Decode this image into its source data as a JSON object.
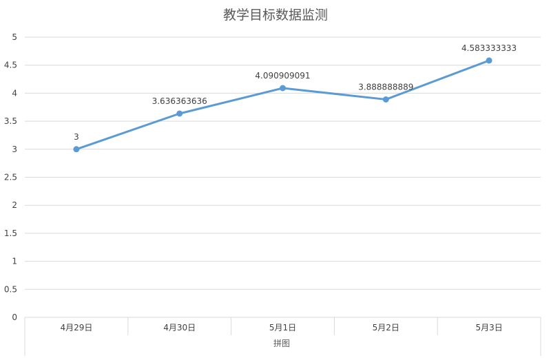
{
  "chart_data": {
    "type": "line",
    "title": "教学目标数据监测",
    "xlabel": "拼图",
    "ylabel": "",
    "categories": [
      "4月29日",
      "4月30日",
      "5月1日",
      "5月2日",
      "5月3日"
    ],
    "series": [
      {
        "values": [
          3,
          3.636363636,
          4.090909091,
          3.888888889,
          4.583333333
        ],
        "labels": [
          "3",
          "3.636363636",
          "4.090909091",
          "3.888888889",
          "4.583333333"
        ],
        "color": "#5b9bd5"
      }
    ],
    "ylim": [
      0,
      5
    ],
    "yticks": [
      "0",
      "0.5",
      "1",
      "1.5",
      "2",
      "2.5",
      "3",
      "3.5",
      "4",
      "4.5",
      "5"
    ],
    "grid": true,
    "colors": {
      "grid": "#d9d9d9",
      "text": "#404040",
      "title": "#595959"
    }
  }
}
